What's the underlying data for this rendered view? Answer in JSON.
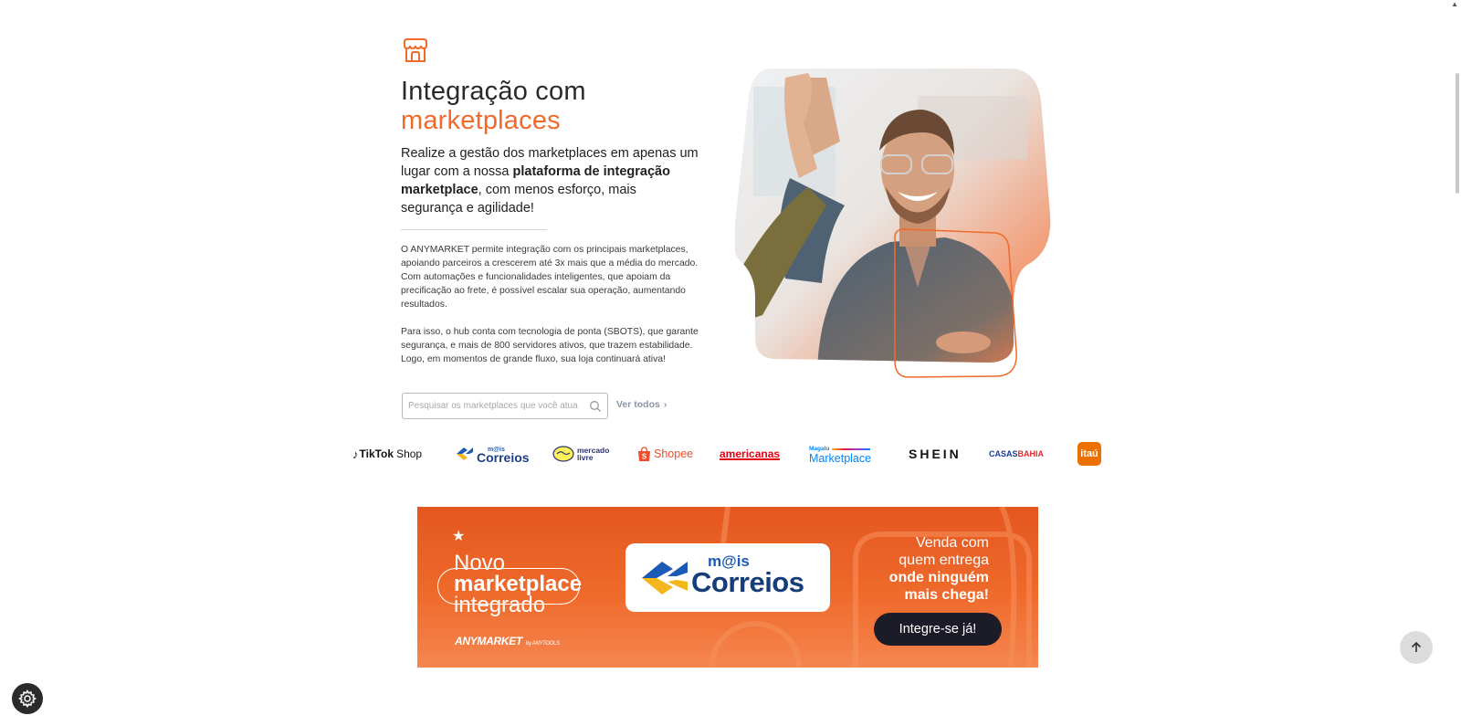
{
  "section": {
    "title_line1": "Integração com",
    "title_line2": "marketplaces",
    "lead_part1": "Realize a gestão dos marketplaces em apenas um lugar com a nossa ",
    "lead_bold": "plataforma de integração marketplace",
    "lead_part2": ", com menos esforço, mais segurança e agilidade!",
    "paragraph1": "O ANYMARKET permite integração com os principais marketplaces, apoiando parceiros a crescerem até 3x mais que a média do mercado. Com automações e funcionalidades inteligentes, que apoiam da precificação ao frete, é possível escalar sua operação, aumentando resultados.",
    "paragraph2": "Para isso, o hub conta com tecnologia de ponta (SBOTS), que garante segurança, e mais de 800 servidores ativos, que trazem estabilidade. Logo, em momentos de grande fluxo, sua loja continuará ativa!",
    "search_placeholder": "Pesquisar os marketplaces que você atua",
    "see_all_label": "Ver todos"
  },
  "logos": {
    "tiktok": "TikTok",
    "tiktok_shop": "Shop",
    "correios_top": "m@is",
    "correios": "Correios",
    "mercado_1": "mercado",
    "mercado_2": "livre",
    "shopee": "Shopee",
    "americanas": "americanas",
    "magalu": "Magalu",
    "magalu_marketplace": "Marketplace",
    "shein": "SHEIN",
    "casas": "CASAS",
    "bahia": "BAHIA",
    "itau": "itaú"
  },
  "banner": {
    "headline_1": "Novo",
    "headline_2": "marketplace",
    "headline_3": "integrado",
    "brand": "ANYMARKET",
    "brand_sub": "by ANYTOOLS",
    "card_top": "m@is",
    "card_main": "Correios",
    "right_1": "Venda com",
    "right_2": "quem entrega",
    "right_3": "onde ninguém",
    "right_4": "mais chega!",
    "cta": "Integre-se já!"
  },
  "colors": {
    "accent": "#f06a2c",
    "banner": "#e4571f",
    "cta": "#1c1c28"
  }
}
